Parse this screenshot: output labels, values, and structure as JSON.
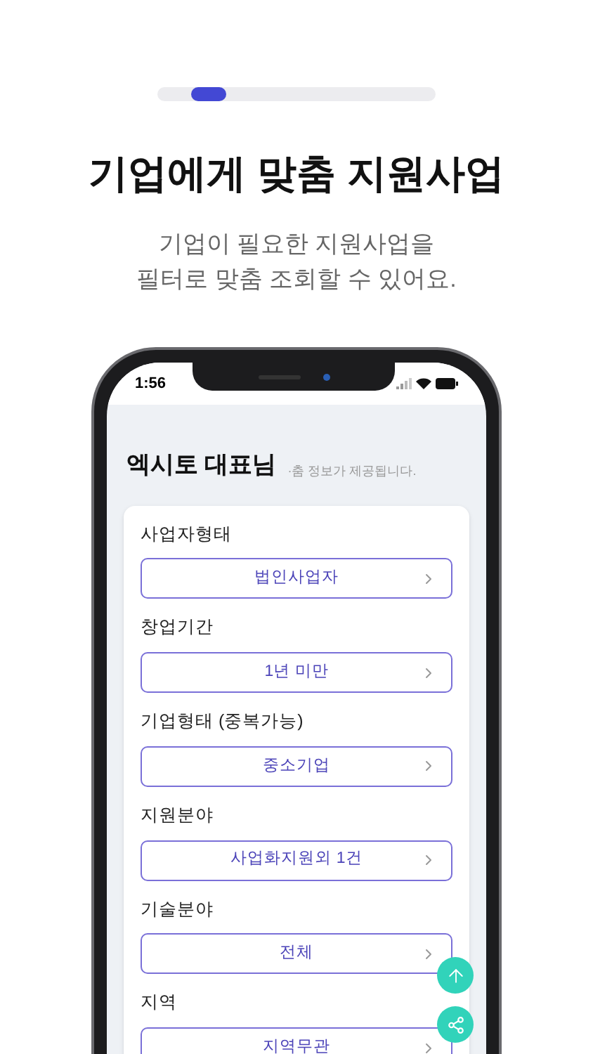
{
  "pager": {
    "level": 0.14
  },
  "title": "기업에게 맞춤 지원사업",
  "subtitle": [
    "기업이 필요한 지원사업을",
    "필터로 맞춤 조회할 수 있어요."
  ],
  "phone": {
    "status_bar": {
      "time": "1:56"
    },
    "greeting": "엑시토 대표님",
    "notice": "·춤 정보가 제공됩니다.",
    "filters": [
      {
        "label": "사업자형태",
        "value": "법인사업자"
      },
      {
        "label": "창업기간",
        "value": "1년 미만"
      },
      {
        "label": "기업형태 (중복가능)",
        "value": "중소기업"
      },
      {
        "label": "지원분야",
        "value": "사업화지원외 1건"
      },
      {
        "label": "기술분야",
        "value": "전체"
      },
      {
        "label": "지역",
        "value": "지역무관"
      }
    ]
  }
}
